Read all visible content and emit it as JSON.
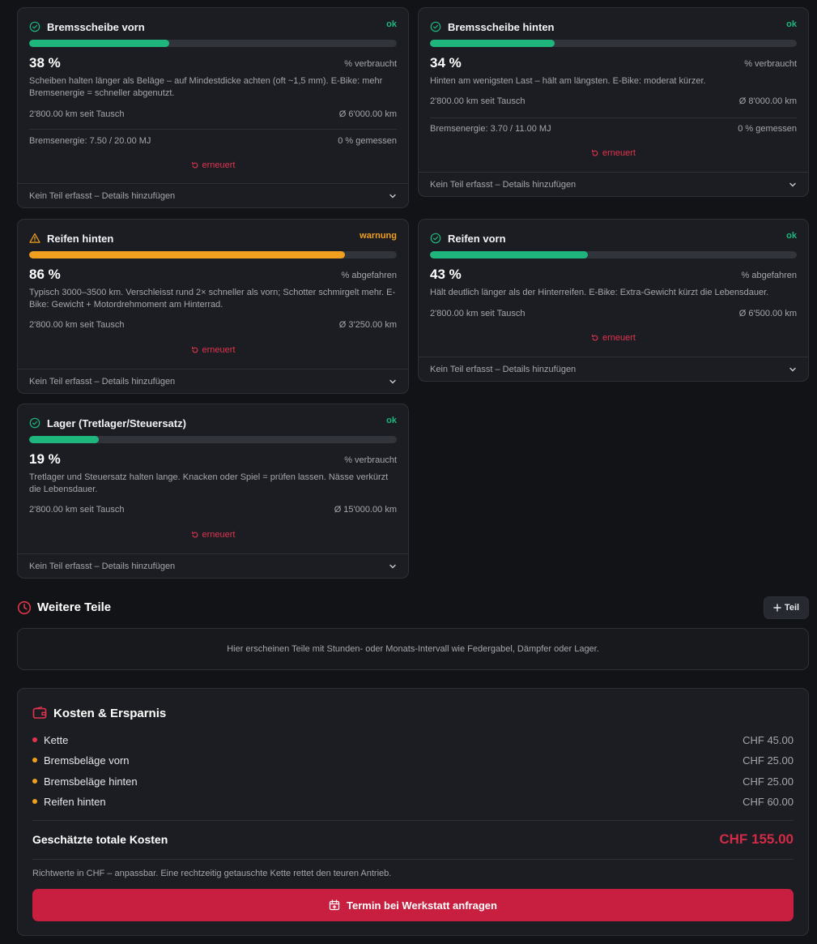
{
  "cards": [
    {
      "title": "Bremsscheibe vorn",
      "status": "ok",
      "progress_percent": 38,
      "percent": "38 %",
      "percent_label": "% verbraucht",
      "description": "Scheiben halten länger als Beläge – auf Mindestdicke achten (oft ~1,5 mm). E-Bike: mehr Bremsenergie = schneller abgenutzt.",
      "km_since": "2'800.00 km seit Tausch",
      "avg": "Ø 6'000.00 km",
      "energy": "Bremsenergie: 7.50 / 20.00 MJ",
      "measured": "0 % gemessen",
      "renew": "erneuert",
      "footer": "Kein Teil erfasst – Details hinzufügen"
    },
    {
      "title": "Bremsscheibe hinten",
      "status": "ok",
      "progress_percent": 34,
      "percent": "34 %",
      "percent_label": "% verbraucht",
      "description": "Hinten am wenigsten Last – hält am längsten. E-Bike: moderat kürzer.",
      "km_since": "2'800.00 km seit Tausch",
      "avg": "Ø 8'000.00 km",
      "energy": "Bremsenergie: 3.70 / 11.00 MJ",
      "measured": "0 % gemessen",
      "renew": "erneuert",
      "footer": "Kein Teil erfasst – Details hinzufügen"
    },
    {
      "title": "Reifen hinten",
      "status": "warnung",
      "progress_percent": 86,
      "percent": "86 %",
      "percent_label": "% abgefahren",
      "description": "Typisch 3000–3500 km. Verschleisst rund 2× schneller als vorn; Schotter schmirgelt mehr. E-Bike: Gewicht + Motordrehmoment am Hinterrad.",
      "km_since": "2'800.00 km seit Tausch",
      "avg": "Ø 3'250.00 km",
      "renew": "erneuert",
      "footer": "Kein Teil erfasst – Details hinzufügen"
    },
    {
      "title": "Reifen vorn",
      "status": "ok",
      "progress_percent": 43,
      "percent": "43 %",
      "percent_label": "% abgefahren",
      "description": "Hält deutlich länger als der Hinterreifen. E-Bike: Extra-Gewicht kürzt die Lebensdauer.",
      "km_since": "2'800.00 km seit Tausch",
      "avg": "Ø 6'500.00 km",
      "renew": "erneuert",
      "footer": "Kein Teil erfasst – Details hinzufügen"
    },
    {
      "title": "Lager (Tretlager/Steuersatz)",
      "status": "ok",
      "progress_percent": 19,
      "percent": "19 %",
      "percent_label": "% verbraucht",
      "description": "Tretlager und Steuersatz halten lange. Knacken oder Spiel = prüfen lassen. Nässe verkürzt die Lebensdauer.",
      "km_since": "2'800.00 km seit Tausch",
      "avg": "Ø 15'000.00 km",
      "renew": "erneuert",
      "footer": "Kein Teil erfasst – Details hinzufügen"
    }
  ],
  "further": {
    "title": "Weitere Teile",
    "add_label": "Teil",
    "info": "Hier erscheinen Teile mit Stunden- oder Monats-Intervall wie Federgabel, Dämpfer oder Lager."
  },
  "costs": {
    "title": "Kosten & Ersparnis",
    "items": [
      {
        "name": "Kette",
        "amount": "CHF 45.00",
        "color": "#e0344e"
      },
      {
        "name": "Bremsbeläge vorn",
        "amount": "CHF 25.00",
        "color": "#f0a01e"
      },
      {
        "name": "Bremsbeläge hinten",
        "amount": "CHF 25.00",
        "color": "#f0a01e"
      },
      {
        "name": "Reifen hinten",
        "amount": "CHF 60.00",
        "color": "#f0a01e"
      }
    ],
    "total_label": "Geschätzte totale Kosten",
    "total_value": "CHF 155.00",
    "note": "Richtwerte in CHF – anpassbar. Eine rechtzeitig getauschte Kette rettet den teuren Antrieb.",
    "cta": "Termin bei Werkstatt anfragen"
  },
  "colors": {
    "ok": "#1fb67d",
    "warning": "#f0a01e",
    "accent": "#c81e3f"
  }
}
